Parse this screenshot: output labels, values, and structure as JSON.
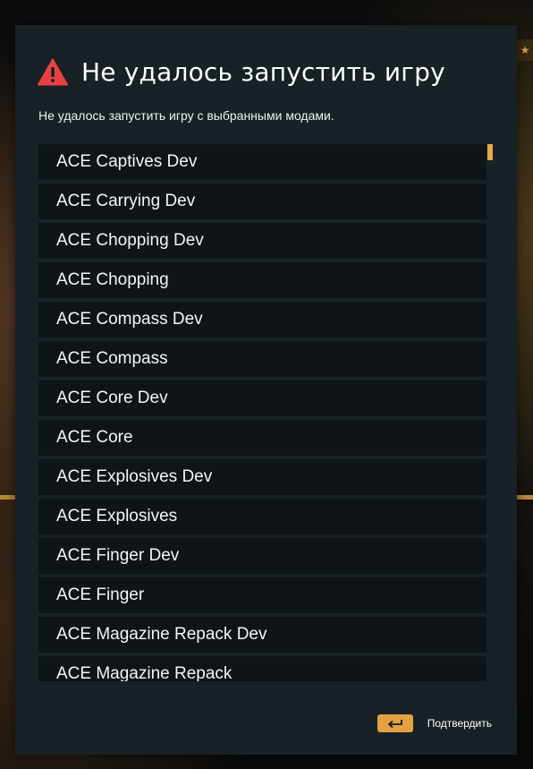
{
  "dialog": {
    "title": "Не удалось запустить игру",
    "subtitle": "Не удалось запустить игру с выбранными модами.",
    "icon": "warning-triangle-icon",
    "accent_color": "#e2a243",
    "warning_color": "#e84141"
  },
  "mods": [
    {
      "label": "ACE Captives Dev"
    },
    {
      "label": "ACE Carrying Dev"
    },
    {
      "label": "ACE Chopping Dev"
    },
    {
      "label": "ACE Chopping"
    },
    {
      "label": "ACE Compass Dev"
    },
    {
      "label": "ACE Compass"
    },
    {
      "label": "ACE Core Dev"
    },
    {
      "label": "ACE Core"
    },
    {
      "label": "ACE Explosives Dev"
    },
    {
      "label": "ACE Explosives"
    },
    {
      "label": "ACE Finger Dev"
    },
    {
      "label": "ACE Finger"
    },
    {
      "label": "ACE Magazine Repack Dev"
    },
    {
      "label": "ACE Magazine Repack"
    }
  ],
  "footer": {
    "key_icon": "enter-key-icon",
    "confirm_label": "Подтвердить"
  }
}
